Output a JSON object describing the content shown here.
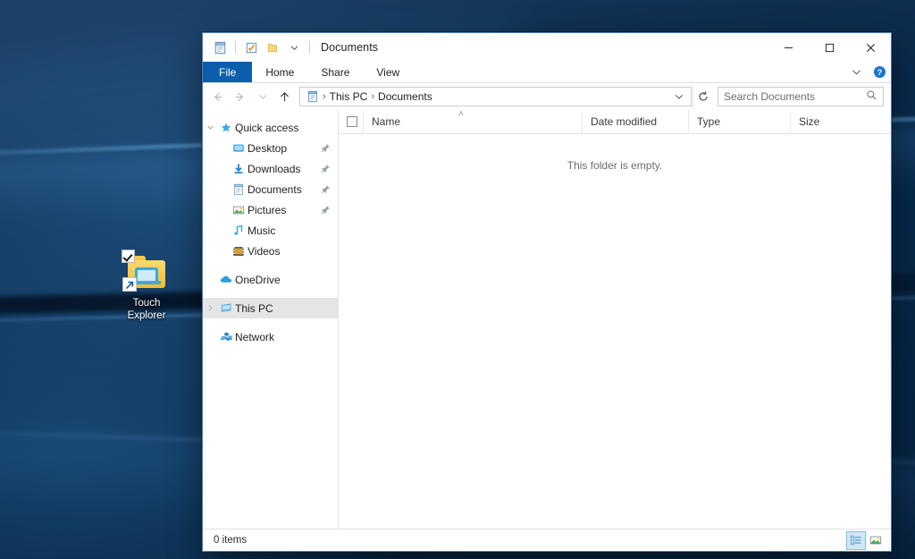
{
  "desktop": {
    "icon": {
      "label_line1": "Touch",
      "label_line2": "Explorer",
      "name": "Touch Explorer",
      "checkbox_checked": true,
      "is_shortcut": true
    },
    "wallpaper_color": "#07294a"
  },
  "window": {
    "title": "Documents",
    "quick_access_toolbar": [
      {
        "name": "properties-icon",
        "tooltip": "Properties"
      },
      {
        "name": "new-folder-icon",
        "tooltip": "New folder"
      },
      {
        "name": "customize-chevron-icon",
        "tooltip": "Customize Quick Access Toolbar"
      }
    ],
    "controls": {
      "minimize": "–",
      "maximize": "□",
      "close": "✕"
    },
    "accent_color": "#0c5fad",
    "border_color": "#4a7fb0"
  },
  "ribbon": {
    "tabs": [
      {
        "label": "File",
        "active": true
      },
      {
        "label": "Home",
        "active": false
      },
      {
        "label": "Share",
        "active": false
      },
      {
        "label": "View",
        "active": false
      }
    ],
    "expand_label": "Expand the Ribbon",
    "help_label": "Help"
  },
  "navigation": {
    "back_label": "Back",
    "forward_label": "Forward",
    "recent_label": "Recent locations",
    "up_label": "Up",
    "breadcrumb": {
      "icon": "documents-folder-icon",
      "parts": [
        "This PC",
        "Documents"
      ],
      "separator": "›"
    },
    "refresh_label": "Refresh",
    "dropdown_label": "Previous locations"
  },
  "search": {
    "placeholder": "Search Documents",
    "value": "",
    "icon": "search-icon"
  },
  "sidebar": {
    "groups": [
      {
        "label": "Quick access",
        "icon": "star-icon",
        "expanded": true,
        "items": [
          {
            "label": "Desktop",
            "icon": "desktop-icon",
            "pinned": true
          },
          {
            "label": "Downloads",
            "icon": "download-icon",
            "pinned": true
          },
          {
            "label": "Documents",
            "icon": "document-icon",
            "pinned": true
          },
          {
            "label": "Pictures",
            "icon": "picture-icon",
            "pinned": true
          },
          {
            "label": "Music",
            "icon": "music-icon",
            "pinned": false
          },
          {
            "label": "Videos",
            "icon": "video-icon",
            "pinned": false
          }
        ]
      },
      {
        "label": "OneDrive",
        "icon": "cloud-icon",
        "expanded": false,
        "selected": false,
        "items": []
      },
      {
        "label": "This PC",
        "icon": "this-pc-icon",
        "expanded": false,
        "selected": true,
        "items": []
      },
      {
        "label": "Network",
        "icon": "network-icon",
        "expanded": false,
        "selected": false,
        "items": []
      }
    ]
  },
  "filelist": {
    "columns": [
      {
        "label": "Name",
        "sorted": true,
        "sort_dir": "asc"
      },
      {
        "label": "Date modified",
        "sorted": false,
        "sort_dir": ""
      },
      {
        "label": "Type",
        "sorted": false,
        "sort_dir": ""
      },
      {
        "label": "Size",
        "sorted": false,
        "sort_dir": ""
      }
    ],
    "sort_caret": "˄",
    "rows": [],
    "empty_message": "This folder is empty."
  },
  "statusbar": {
    "item_count_text": "0 items",
    "views": [
      {
        "name": "details-view",
        "label": "Details view",
        "active": true
      },
      {
        "name": "large-icons-view",
        "label": "Large icons view",
        "active": false
      }
    ]
  }
}
